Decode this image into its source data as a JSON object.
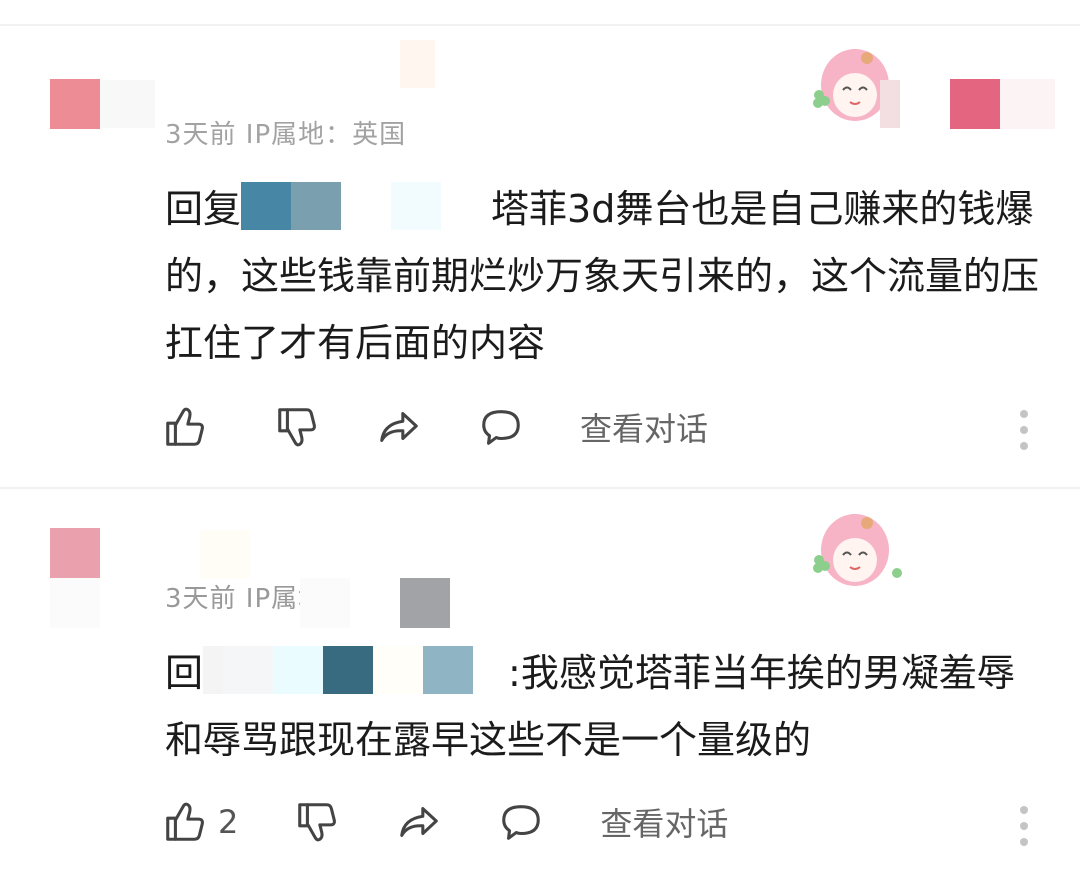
{
  "comments": [
    {
      "meta": "3天前 IP属地：英国",
      "reply_prefix": "回复",
      "reply_rest": "塔菲3d舞台也是自己赚来的钱爆的，这些钱靠前期烂炒万象天引来的，这个流量的压扛住了才有后面的内容",
      "like_count": "",
      "view_label": "查看对话",
      "icons": [
        "like-icon",
        "dislike-icon",
        "share-icon",
        "comment-icon",
        "more-icon"
      ]
    },
    {
      "meta": "3天前 IP属地",
      "reply_prefix": "回",
      "reply_rest": ":我感觉塔菲当年挨的男凝羞辱和辱骂跟现在露早这些不是一个量级的",
      "like_count": "2",
      "view_label": "查看对话",
      "icons": [
        "like-icon",
        "dislike-icon",
        "share-icon",
        "comment-icon",
        "more-icon"
      ]
    }
  ],
  "colors": {
    "avatar_pink": "#ee8c96",
    "badge_pink": "#e3657f",
    "meta_gray": "#999999",
    "icon_gray": "#444444"
  }
}
